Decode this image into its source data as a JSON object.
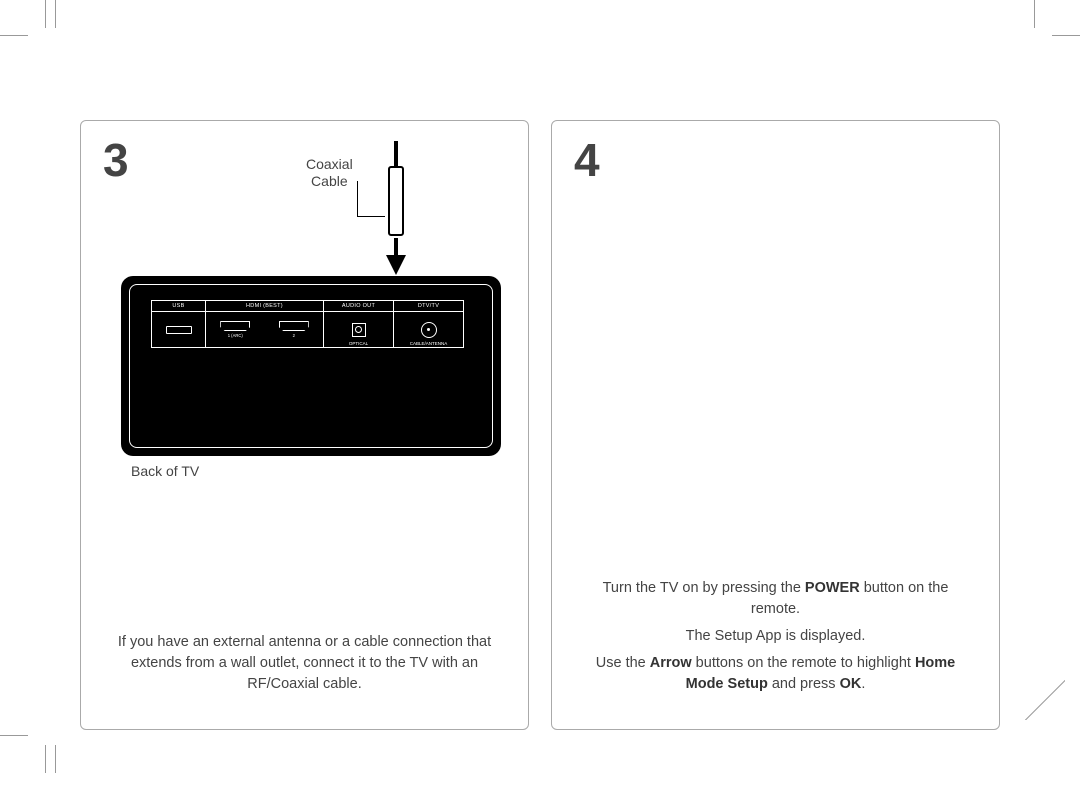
{
  "step3": {
    "number": "3",
    "coax_label_l1": "Coaxial",
    "coax_label_l2": "Cable",
    "back_label": "Back of TV",
    "ports": {
      "usb": "USB",
      "hdmi": "HDMI (BEST)",
      "hdmi1": "1 (ARC)",
      "hdmi2": "2",
      "audio": "AUDIO OUT",
      "optical": "OPTICAL",
      "dtv": "DTV/TV",
      "cable_ant": "CABLE/ANTENNA"
    },
    "text": "If you have an external antenna or a cable connection that extends from a wall outlet, connect it to the TV with an RF/Coaxial cable."
  },
  "step4": {
    "number": "4",
    "p1_pre": "Turn the TV on by pressing the ",
    "p1_b": "POWER",
    "p1_post": " button on the remote.",
    "p2": "The Setup App is displayed.",
    "p3_pre": "Use the ",
    "p3_b1": "Arrow",
    "p3_mid": " buttons on the remote to highlight ",
    "p3_b2": "Home Mode Setup",
    "p3_mid2": " and press ",
    "p3_b3": "OK",
    "p3_post": "."
  }
}
